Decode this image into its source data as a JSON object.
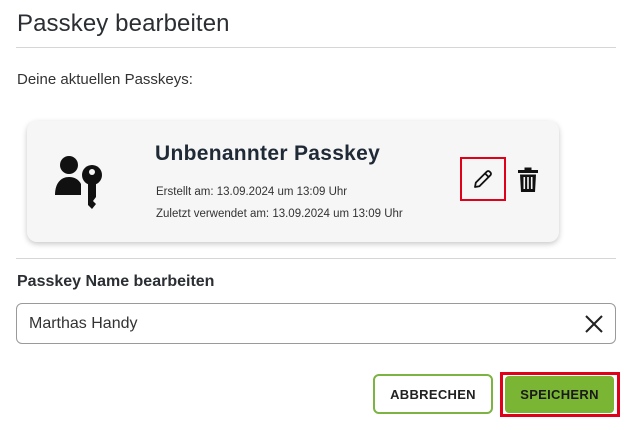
{
  "dialog": {
    "title": "Passkey bearbeiten",
    "current_label": "Deine aktuellen Passkeys:"
  },
  "passkey": {
    "name": "Unbenannter Passkey",
    "created": "Erstellt am: 13.09.2024 um 13:09 Uhr",
    "last_used": "Zuletzt verwendet am: 13.09.2024 um 13:09 Uhr",
    "icon": "user-key-icon",
    "edit_icon": "pencil-icon",
    "delete_icon": "trash-icon"
  },
  "edit_form": {
    "label": "Passkey Name bearbeiten",
    "value": "Marthas Handy",
    "clear_icon": "close-icon"
  },
  "actions": {
    "cancel_label": "ABBRECHEN",
    "save_label": "SPEICHERN"
  },
  "colors": {
    "accent_green": "#7ab634",
    "highlight_red": "#e0001a"
  }
}
